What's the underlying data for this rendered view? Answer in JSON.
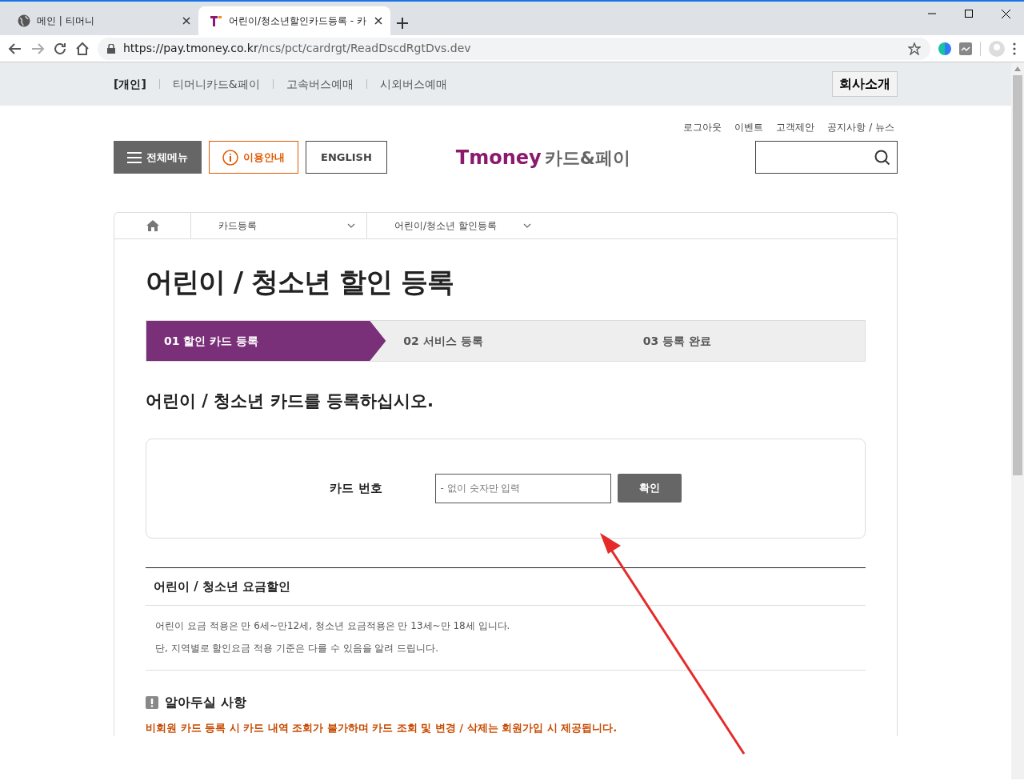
{
  "browser": {
    "tabs": [
      {
        "title": "메인 | 티머니",
        "selected": false,
        "kind": "globe"
      },
      {
        "title": "어린이/청소년할인카드등록 - 카",
        "selected": true,
        "kind": "logo"
      }
    ],
    "url_host": "https://pay.tmoney.co.kr",
    "url_path": "/ncs/pct/cardrgt/ReadDscdRgtDvs.dev"
  },
  "top_nav": {
    "items": [
      {
        "label": "[개인]",
        "selected": true
      },
      {
        "label": "티머니카드&페이",
        "selected": false
      },
      {
        "label": "고속버스예매",
        "selected": false
      },
      {
        "label": "시외버스예매",
        "selected": false
      }
    ],
    "company_button": "회사소개"
  },
  "util_links": [
    "로그아웃",
    "이벤트",
    "고객제안",
    "공지사항 / 뉴스"
  ],
  "header": {
    "menu_button": "전체메뉴",
    "guide_button": "이용안내",
    "english_button": "ENGLISH",
    "logo_brand": "Tmoney",
    "logo_suffix": "카드&페이"
  },
  "breadcrumb": [
    "카드등록",
    "어린이/청소년 할인등록"
  ],
  "page_title": "어린이 / 청소년 할인 등록",
  "steps": [
    {
      "label": "01 할인 카드 등록",
      "selected": true
    },
    {
      "label": "02 서비스 등록",
      "selected": false
    },
    {
      "label": "03 등록 완료",
      "selected": false
    }
  ],
  "section_heading": "어린이 / 청소년 카드를 등록하십시오.",
  "form": {
    "label": "카드 번호",
    "placeholder": "- 없이 숫자만 입력",
    "button": "확인"
  },
  "info": {
    "title": "어린이 / 청소년 요금할인",
    "lines": [
      "어린이 요금 적용은 만 6세~만12세, 청소년 요금적용은 만 13세~만 18세 입니다.",
      "단, 지역별로 할인요금 적용 기준은 다를 수 있음을 알려 드립니다."
    ]
  },
  "notice": {
    "title": "알아두실 사항",
    "items": [
      "비회원 카드 등록 시 카드 내역 조회가 불가하며 카드 조회 및 변경 / 삭제는 회원가입 시 제공됩니다."
    ]
  }
}
